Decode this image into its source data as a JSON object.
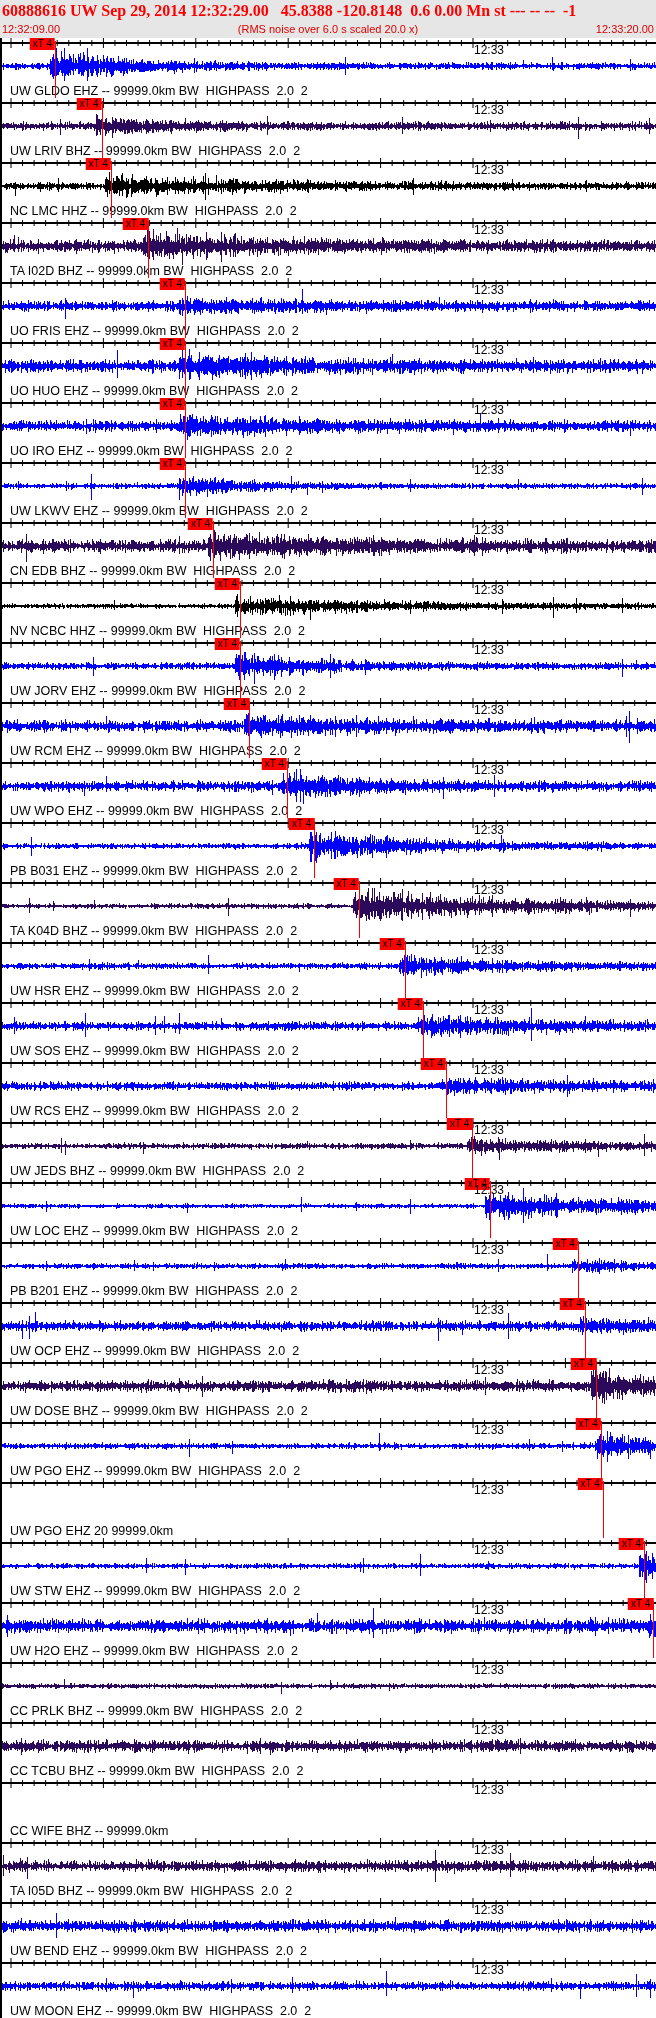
{
  "header": {
    "title": "60888616 UW Sep 29, 2014 12:32:29.00   45.8388 -120.8148  0.6 0.00 Mn st --- -- --  -1",
    "start_time": "12:32:09.00",
    "note": "(RMS noise over 6.0 s scaled 20.0 x)",
    "end_time": "12:33:20.00"
  },
  "traces": [
    {
      "label": "UW GLDO EHZ -- 99999.0km BW  HIGHPASS  2.0  2",
      "color": "#0000ff",
      "signal": true,
      "minute_label": "12:33",
      "pick": {
        "label": "xT 4",
        "level": 0.084
      }
    },
    {
      "label": "UW LRIV BHZ -- 99999.0km BW  HIGHPASS  2.0  2",
      "color": "#2b0a5c",
      "signal": true,
      "minute_label": "12:33",
      "pick": {
        "label": "xT 4",
        "level": 0.155
      }
    },
    {
      "label": "NC LMC HHZ -- 99999.0km BW  HIGHPASS  2.0  2",
      "color": "#000000",
      "signal": true,
      "minute_label": "12:33",
      "pick": {
        "label": "xT 4",
        "level": 0.169
      }
    },
    {
      "label": "TA I02D BHZ -- 99999.0km BW  HIGHPASS  2.0  2",
      "color": "#2b0a5c",
      "signal": true,
      "minute_label": "12:33",
      "pick": {
        "label": "xT 4",
        "level": 0.226
      }
    },
    {
      "label": "UO FRIS EHZ -- 99999.0km BW  HIGHPASS  2.0  2",
      "color": "#0000ff",
      "signal": true,
      "minute_label": "12:33",
      "pick": {
        "label": "xT 4",
        "level": 0.282
      }
    },
    {
      "label": "UO HUO EHZ -- 99999.0km BW  HIGHPASS  2.0  2",
      "color": "#0000ff",
      "signal": true,
      "minute_label": "12:33",
      "pick": {
        "label": "xT 4",
        "level": 0.282
      }
    },
    {
      "label": "UO IRO EHZ -- 99999.0km BW  HIGHPASS  2.0  2",
      "color": "#0000ff",
      "signal": true,
      "minute_label": "12:33",
      "pick": {
        "label": "xT 4",
        "level": 0.282
      }
    },
    {
      "label": "UW LKWV EHZ -- 99999.0km BW  HIGHPASS  2.0  2",
      "color": "#0000ff",
      "signal": true,
      "minute_label": "12:33",
      "pick": {
        "label": "xT 4",
        "level": 0.282
      }
    },
    {
      "label": "CN EDB BHZ -- 99999.0km BW  HIGHPASS  2.0  2",
      "color": "#2b0a5c",
      "signal": true,
      "minute_label": "12:33",
      "pick": {
        "label": "xT 4",
        "level": 0.325
      }
    },
    {
      "label": "NV NCBC HHZ -- 99999.0km BW  HIGHPASS  2.0  2",
      "color": "#000000",
      "signal": true,
      "minute_label": "12:33",
      "pick": {
        "label": "xT 4",
        "level": 0.366
      }
    },
    {
      "label": "UW JORV EHZ -- 99999.0km BW  HIGHPASS  2.0  2",
      "color": "#0000ff",
      "signal": true,
      "minute_label": "12:33",
      "pick": {
        "label": "xT 4",
        "level": 0.366
      }
    },
    {
      "label": "UW RCM EHZ -- 99999.0km BW  HIGHPASS  2.0  2",
      "color": "#0000ff",
      "signal": true,
      "minute_label": "12:33",
      "pick": {
        "label": "xT 4",
        "level": 0.38
      }
    },
    {
      "label": "UW WPO EHZ -- 99999.0km BW  HIGHPASS  2.0  2",
      "color": "#0000ff",
      "signal": true,
      "minute_label": "12:33",
      "pick": {
        "label": "xT 4",
        "level": 0.4375
      }
    },
    {
      "label": "PB B031 EHZ -- 99999.0km BW  HIGHPASS  2.0  2",
      "color": "#0000ff",
      "signal": true,
      "minute_label": "12:33",
      "pick": {
        "label": "xT 4",
        "level": 0.479
      }
    },
    {
      "label": "TA K04D BHZ -- 99999.0km BW  HIGHPASS  2.0  2",
      "color": "#2b0a5c",
      "signal": true,
      "minute_label": "12:33",
      "pick": {
        "label": "xT 4",
        "level": 0.547
      }
    },
    {
      "label": "UW HSR EHZ -- 99999.0km BW  HIGHPASS  2.0  2",
      "color": "#0000ff",
      "signal": true,
      "minute_label": "12:33",
      "pick": {
        "label": "xT 4",
        "level": 0.617
      }
    },
    {
      "label": "UW SOS EHZ -- 99999.0km BW  HIGHPASS  2.0  2",
      "color": "#0000ff",
      "signal": true,
      "minute_label": "12:33",
      "pick": {
        "label": "xT 4",
        "level": 0.645
      }
    },
    {
      "label": "UW RCS EHZ -- 99999.0km BW  HIGHPASS  2.0  2",
      "color": "#0000ff",
      "signal": true,
      "minute_label": "12:33",
      "pick": {
        "label": "xT 4",
        "level": 0.68
      }
    },
    {
      "label": "UW JEDS BHZ -- 99999.0km BW  HIGHPASS  2.0  2",
      "color": "#2b0a5c",
      "signal": true,
      "minute_label": "12:33",
      "pick": {
        "label": "xT 4",
        "level": 0.72
      }
    },
    {
      "label": "UW LOC EHZ -- 99999.0km BW  HIGHPASS  2.0  2",
      "color": "#0000ff",
      "signal": true,
      "minute_label": "12:33",
      "pick": {
        "label": "xT 4",
        "level": 0.747
      }
    },
    {
      "label": "PB B201 EHZ -- 99999.0km BW  HIGHPASS  2.0  2",
      "color": "#0000ff",
      "signal": true,
      "minute_label": "12:33",
      "pick": {
        "label": "xT 4",
        "level": 0.881
      }
    },
    {
      "label": "UW OCP EHZ -- 99999.0km BW  HIGHPASS  2.0  2",
      "color": "#0000ff",
      "signal": true,
      "minute_label": "12:33",
      "pick": {
        "label": "xT 4",
        "level": 0.892
      }
    },
    {
      "label": "UW DOSE BHZ -- 99999.0km BW  HIGHPASS  2.0  2",
      "color": "#2b0a5c",
      "signal": true,
      "minute_label": "12:33",
      "pick": {
        "label": "xT 4",
        "level": 0.909
      }
    },
    {
      "label": "UW PGO EHZ -- 99999.0km BW  HIGHPASS  2.0  2",
      "color": "#0000ff",
      "signal": true,
      "minute_label": "12:33",
      "pick": {
        "label": "xT 4",
        "level": 0.916
      }
    },
    {
      "label": "UW PGO EHZ 20 99999.0km",
      "signal": false,
      "minute_label": "12:33",
      "pick": {
        "label": "xT 4",
        "level": 0.919
      }
    },
    {
      "label": "UW STW EHZ -- 99999.0km BW  HIGHPASS  2.0  2",
      "color": "#0000ff",
      "signal": true,
      "minute_label": "12:33",
      "pick": {
        "label": "xT 4",
        "level": 0.982
      }
    },
    {
      "label": "UW H2O EHZ -- 99999.0km BW  HIGHPASS  2.0  2",
      "color": "#0000ff",
      "signal": true,
      "minute_label": "12:33",
      "pick": {
        "label": "xT 4",
        "level": 0.996
      }
    },
    {
      "label": "CC PRLK BHZ -- 99999.0km BW  HIGHPASS  2.0  2",
      "color": "#2b0a5c",
      "signal": true,
      "minute_label": "12:33"
    },
    {
      "label": "CC TCBU BHZ -- 99999.0km BW  HIGHPASS  2.0  2",
      "color": "#2b0a5c",
      "signal": true,
      "minute_label": "12:33"
    },
    {
      "label": "CC WIFE BHZ -- 99999.0km",
      "signal": false,
      "minute_label": "12:33"
    },
    {
      "label": "TA I05D BHZ -- 99999.0km BW  HIGHPASS  2.0  2",
      "color": "#2b0a5c",
      "signal": true,
      "minute_label": "12:33"
    },
    {
      "label": "UW BEND EHZ -- 99999.0km BW  HIGHPASS  2.0  2",
      "color": "#0000ff",
      "signal": true,
      "minute_label": "12:33"
    },
    {
      "label": "UW MOON EHZ -- 99999.0km BW  HIGHPASS  2.0  2",
      "color": "#0000ff",
      "signal": true,
      "minute_label": "12:33"
    }
  ]
}
